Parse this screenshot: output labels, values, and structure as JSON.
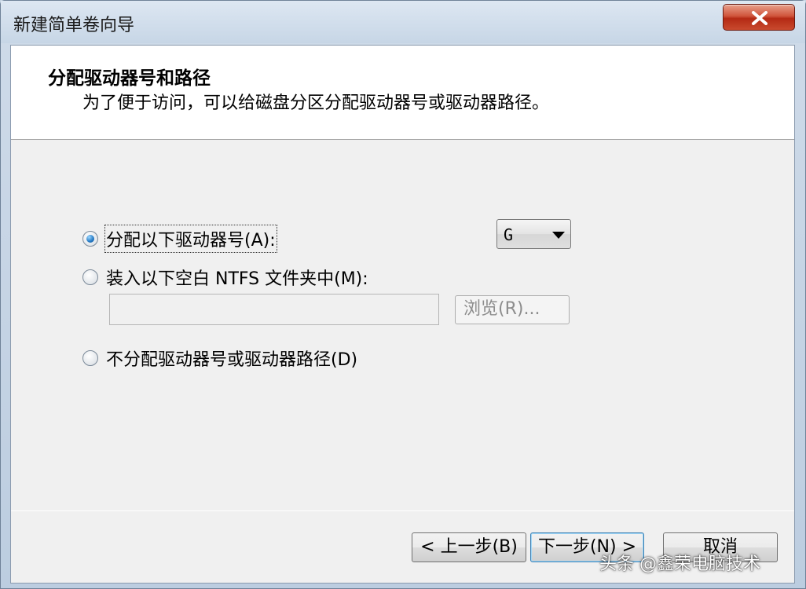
{
  "window": {
    "title": "新建简单卷向导"
  },
  "header": {
    "title": "分配驱动器号和路径",
    "subtitle": "为了便于访问，可以给磁盘分区分配驱动器号或驱动器路径。"
  },
  "options": {
    "assign_letter": {
      "label": "分配以下驱动器号(A):",
      "checked": true
    },
    "mount_folder": {
      "label": "装入以下空白 NTFS 文件夹中(M):",
      "checked": false
    },
    "no_assign": {
      "label": "不分配驱动器号或驱动器路径(D)",
      "checked": false
    }
  },
  "drive_letter": {
    "value": "G"
  },
  "folder_path": {
    "value": ""
  },
  "browse_label": "浏览(R)...",
  "buttons": {
    "back": "< 上一步(B)",
    "next": "下一步(N) >",
    "cancel": "取消"
  },
  "watermark": "头条 @鑫荣电脑技术",
  "colors": {
    "close_button": "#c94a2e",
    "radio_selected": "#2b7fc8",
    "default_button_border": "#3c7fb1"
  },
  "icons": {
    "close": "close-icon",
    "dropdown": "chevron-down-icon"
  }
}
